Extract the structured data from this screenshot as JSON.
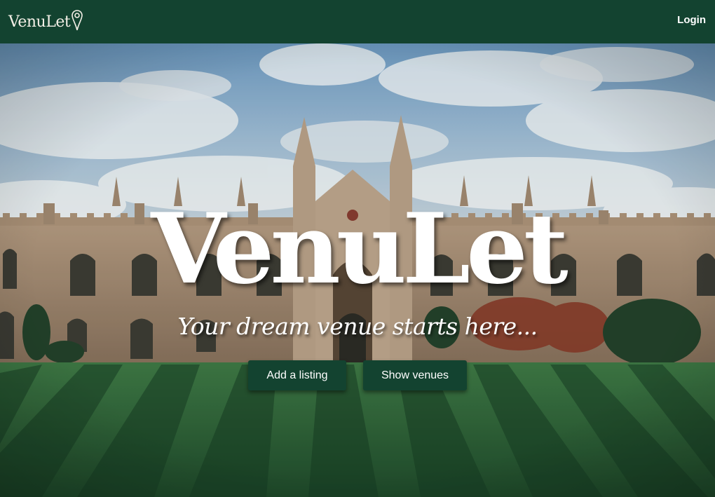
{
  "brand": {
    "logo_text": "VenuLet",
    "logo_icon": "map-pin-icon",
    "color_primary": "#134330"
  },
  "nav": {
    "login_label": "Login"
  },
  "hero": {
    "title": "VenuLet",
    "subtitle": "Your dream venue starts here...",
    "background": "gothic-college-courtyard-photo",
    "add_listing_label": "Add a listing",
    "show_venues_label": "Show venues"
  }
}
